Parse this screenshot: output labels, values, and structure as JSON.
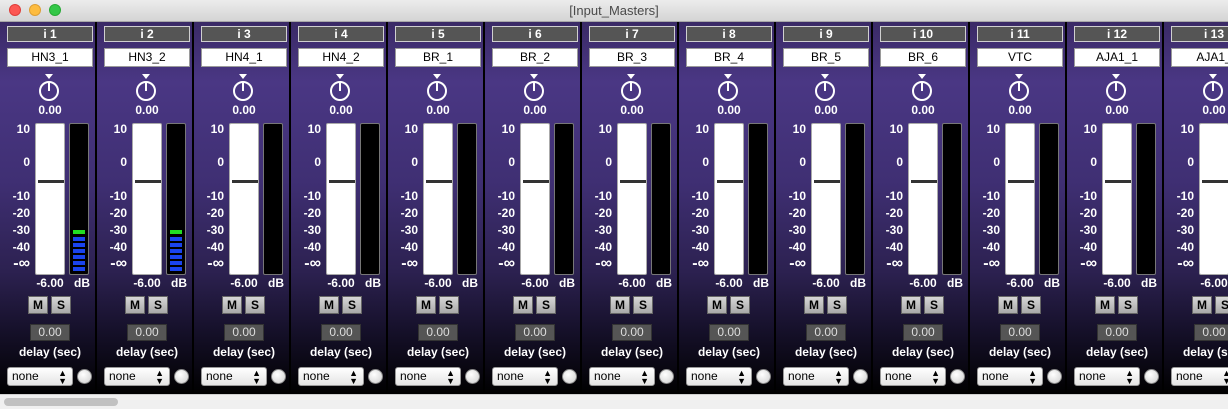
{
  "window": {
    "title": "[Input_Masters]"
  },
  "strip_common": {
    "pan_value": "0.00",
    "scale_labels": [
      "10",
      "0",
      "-10",
      "-20",
      "-30",
      "-40",
      "-∞"
    ],
    "fader_value": "-6.00",
    "db_label": "dB",
    "mute_label": "M",
    "solo_label": "S",
    "delay_value": "0.00",
    "delay_label": "delay (sec)",
    "routing_select_value": "none"
  },
  "colors": {
    "strip_purple": "#4a3784",
    "meter_green": "#22dd22",
    "meter_blue": "#1a44ee"
  },
  "strips": [
    {
      "id": "i 1",
      "name": "HN3_1",
      "meter_active": true
    },
    {
      "id": "i 2",
      "name": "HN3_2",
      "meter_active": true
    },
    {
      "id": "i 3",
      "name": "HN4_1",
      "meter_active": false
    },
    {
      "id": "i 4",
      "name": "HN4_2",
      "meter_active": false
    },
    {
      "id": "i 5",
      "name": "BR_1",
      "meter_active": false
    },
    {
      "id": "i 6",
      "name": "BR_2",
      "meter_active": false
    },
    {
      "id": "i 7",
      "name": "BR_3",
      "meter_active": false
    },
    {
      "id": "i 8",
      "name": "BR_4",
      "meter_active": false
    },
    {
      "id": "i 9",
      "name": "BR_5",
      "meter_active": false
    },
    {
      "id": "i 10",
      "name": "BR_6",
      "meter_active": false
    },
    {
      "id": "i 11",
      "name": "VTC",
      "meter_active": false
    },
    {
      "id": "i 12",
      "name": "AJA1_1",
      "meter_active": false
    },
    {
      "id": "i 13",
      "name": "AJA1_",
      "meter_active": false
    }
  ]
}
